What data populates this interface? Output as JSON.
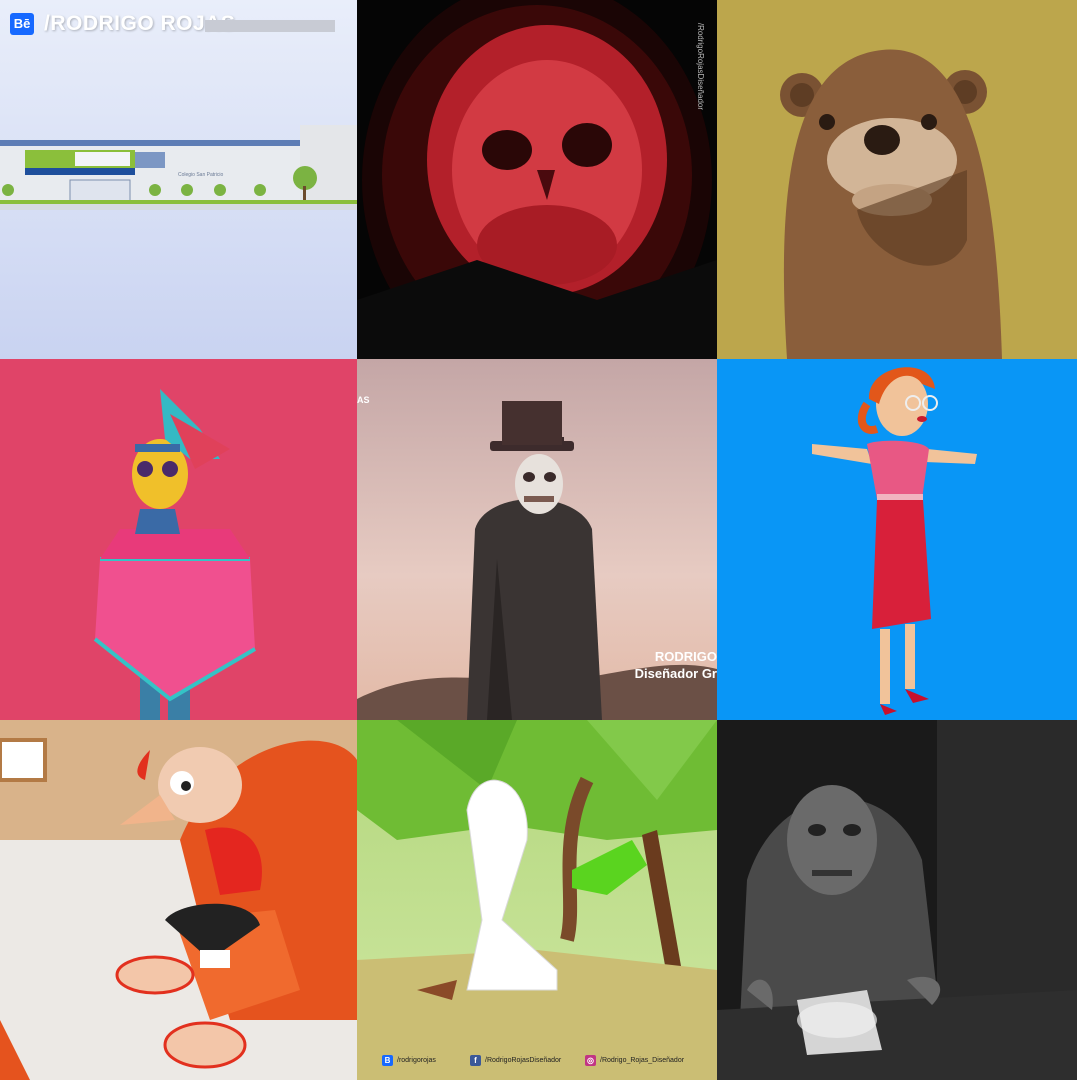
{
  "header": {
    "behance_badge": "Bē",
    "title": "/RODRIGO ROJAS"
  },
  "tiles": {
    "school": {
      "sign": "Colegio San Patricio"
    },
    "skull": {
      "vertical_text": "/RodrigoRojasDiseñador"
    },
    "ghost": {
      "side_label": "AS",
      "name_line": "RODRIGO",
      "role_line": "Diseñador Gr"
    }
  },
  "footer": {
    "behance": "/rodrigorojas",
    "facebook": "/RodrigoRojasDiseñador",
    "instagram": "/Rodrigo_Rojas_Diseñador"
  },
  "colors": {
    "behance": "#1769ff",
    "facebook": "#3b5998",
    "instagram": "#c13584",
    "pink": "#e04468",
    "blue": "#0996f6",
    "mustard": "#bca64c"
  },
  "icons": [
    "behance-icon",
    "facebook-icon",
    "instagram-icon"
  ]
}
